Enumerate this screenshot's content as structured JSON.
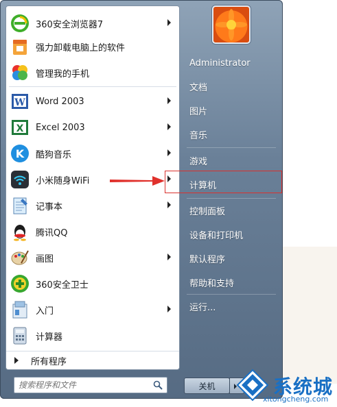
{
  "left_items": [
    {
      "label": "360安全浏览器7",
      "icon": "browser-360-icon",
      "arrow": true
    },
    {
      "label": "强力卸载电脑上的软件",
      "icon": "uninstall-icon",
      "arrow": false
    },
    {
      "label": "管理我的手机",
      "icon": "phone-manager-icon",
      "arrow": false
    },
    {
      "label": "Word 2003",
      "icon": "word-icon",
      "arrow": true
    },
    {
      "label": "Excel 2003",
      "icon": "excel-icon",
      "arrow": true
    },
    {
      "label": "酷狗音乐",
      "icon": "kugou-icon",
      "arrow": true
    },
    {
      "label": "小米随身WiFi",
      "icon": "wifi-icon",
      "arrow": true
    },
    {
      "label": "记事本",
      "icon": "notepad-icon",
      "arrow": true
    },
    {
      "label": "腾讯QQ",
      "icon": "qq-icon",
      "arrow": false
    },
    {
      "label": "画图",
      "icon": "paint-icon",
      "arrow": true
    },
    {
      "label": "360安全卫士",
      "icon": "security-360-icon",
      "arrow": false
    },
    {
      "label": "入门",
      "icon": "getting-started-icon",
      "arrow": true
    },
    {
      "label": "计算器",
      "icon": "calculator-icon",
      "arrow": false
    }
  ],
  "all_programs": "所有程序",
  "search": {
    "placeholder": "搜索程序和文件"
  },
  "user": {
    "name": "Administrator"
  },
  "right_items": [
    {
      "label": "文档"
    },
    {
      "label": "图片"
    },
    {
      "label": "音乐"
    },
    {
      "label": "游戏"
    },
    {
      "label": "计算机"
    },
    {
      "label": "控制面板"
    },
    {
      "label": "设备和打印机"
    },
    {
      "label": "默认程序"
    },
    {
      "label": "帮助和支持"
    },
    {
      "label": "运行..."
    }
  ],
  "shutdown": {
    "label": "关机"
  },
  "watermark": {
    "brand": "系统城",
    "url": "xitongcheng.com"
  },
  "colors": {
    "highlight": "#d9302c",
    "arrow": "#e0312c",
    "menu_panel": "#6a8098"
  }
}
